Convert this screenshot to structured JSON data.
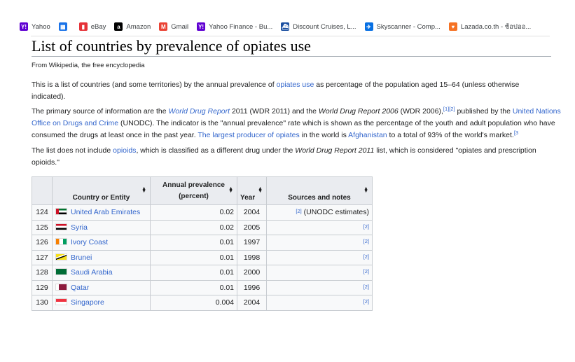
{
  "bookmarks": [
    {
      "label": "Yahoo",
      "icon": "yahoo-icon",
      "color": "#6001d2",
      "glyph": "Y!"
    },
    {
      "label": "",
      "icon": "calendar-icon",
      "color": "#1a73e8",
      "glyph": "▦"
    },
    {
      "label": "eBay",
      "icon": "ebay-icon",
      "color": "#e53238",
      "glyph": "▮"
    },
    {
      "label": "Amazon",
      "icon": "amazon-icon",
      "color": "#000000",
      "glyph": "a"
    },
    {
      "label": "Gmail",
      "icon": "gmail-icon",
      "color": "#ea4335",
      "glyph": "M"
    },
    {
      "label": "Yahoo Finance - Bu...",
      "icon": "yahoo-finance-icon",
      "color": "#6001d2",
      "glyph": "Y!"
    },
    {
      "label": "Discount Cruises, L...",
      "icon": "cruise-icon",
      "color": "#1a4fa0",
      "glyph": "⛴"
    },
    {
      "label": "Skyscanner - Comp...",
      "icon": "skyscanner-icon",
      "color": "#0770e3",
      "glyph": "✈"
    },
    {
      "label": "Lazada.co.th - ช้อปออ...",
      "icon": "lazada-icon",
      "color": "#f57224",
      "glyph": "♥"
    }
  ],
  "article": {
    "title": "List of countries by prevalence of opiates use",
    "tagline": "From Wikipedia, the free encyclopedia",
    "p1": {
      "t1": "This is a list of countries (and some territories) by the annual prevalence of ",
      "link1": "opiates use",
      "t2": " as percentage of the population aged 15–64 (unless otherwise indicated)."
    },
    "p2": {
      "t1": "The primary source of information are the ",
      "i1": "World Drug Report",
      "t2": " 2011 (WDR 2011) and the ",
      "i2": "World Drug Report 2006",
      "t3": " (WDR 2006),",
      "ref": "[1][2]",
      "t4": " published by the ",
      "link1": "United Nations Office on Drugs and Crime",
      "t5": " (UNODC). The indicator is the \"annual prevalence\" rate which is shown as the percentage of the youth and adult population who have consumed the drugs at least once in the past year. ",
      "link2": "The largest producer of opiates",
      "t6": " in the world is ",
      "link3": "Afghanistan",
      "t7": " to a total of 93% of the world's market.",
      "ref2": "[3"
    },
    "p3": {
      "t1": "The list does not include ",
      "link1": "opioids",
      "t2": ", which is classified as a different drug under the ",
      "i1": "World Drug Report 2011",
      "t3": " list, which is considered \"opiates and prescription opioids.\""
    }
  },
  "table": {
    "headers": {
      "country": "Country or Entity",
      "prev_line1": "Annual prevalence",
      "prev_line2": "(percent)",
      "year": "Year",
      "sources": "Sources and notes"
    },
    "sort_icon": "sort-arrows-icon",
    "rows": [
      {
        "rank": "124",
        "country": "United Arab Emirates",
        "flag": "uae-flag-icon",
        "prevalence": "0.02",
        "year": "2004",
        "ref": "[2]",
        "note": " (UNODC estimates)"
      },
      {
        "rank": "125",
        "country": "Syria",
        "flag": "syria-flag-icon",
        "prevalence": "0.02",
        "year": "2005",
        "ref": "[2]",
        "note": ""
      },
      {
        "rank": "126",
        "country": "Ivory Coast",
        "flag": "ivory-coast-flag-icon",
        "prevalence": "0.01",
        "year": "1997",
        "ref": "[2]",
        "note": ""
      },
      {
        "rank": "127",
        "country": "Brunei",
        "flag": "brunei-flag-icon",
        "prevalence": "0.01",
        "year": "1998",
        "ref": "[2]",
        "note": ""
      },
      {
        "rank": "128",
        "country": "Saudi Arabia",
        "flag": "saudi-arabia-flag-icon",
        "prevalence": "0.01",
        "year": "2000",
        "ref": "[2]",
        "note": ""
      },
      {
        "rank": "129",
        "country": "Qatar",
        "flag": "qatar-flag-icon",
        "prevalence": "0.01",
        "year": "1996",
        "ref": "[2]",
        "note": ""
      },
      {
        "rank": "130",
        "country": "Singapore",
        "flag": "singapore-flag-icon",
        "prevalence": "0.004",
        "year": "2004",
        "ref": "[2]",
        "note": ""
      }
    ]
  }
}
